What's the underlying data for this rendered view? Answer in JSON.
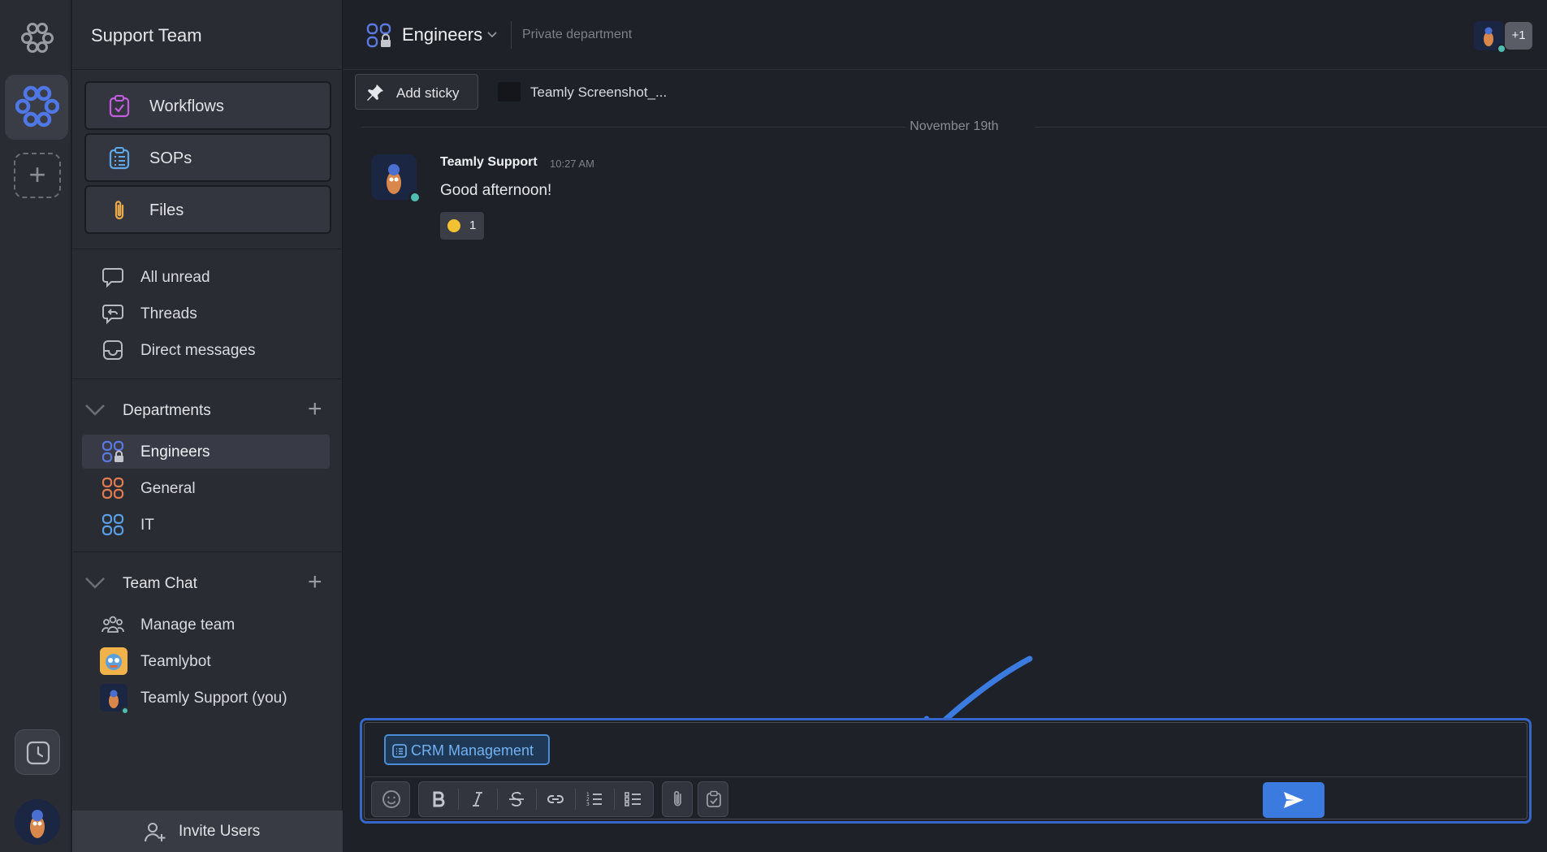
{
  "workspace": {
    "name": "Support Team"
  },
  "tools": [
    {
      "label": "Workflows",
      "icon": "workflows-icon"
    },
    {
      "label": "SOPs",
      "icon": "sops-icon"
    },
    {
      "label": "Files",
      "icon": "paperclip-icon"
    }
  ],
  "nav": [
    {
      "label": "All unread",
      "icon": "chat-bubble-icon"
    },
    {
      "label": "Threads",
      "icon": "threads-icon"
    },
    {
      "label": "Direct messages",
      "icon": "inbox-icon"
    }
  ],
  "departments": {
    "label": "Departments",
    "items": [
      {
        "label": "Engineers",
        "color": "#5b7ae0",
        "active": true,
        "locked": true
      },
      {
        "label": "General",
        "color": "#e07c4f"
      },
      {
        "label": "IT",
        "color": "#5a9fe6"
      }
    ]
  },
  "team_chat": {
    "label": "Team Chat",
    "items": [
      {
        "label": "Manage team",
        "icon": "team-icon"
      },
      {
        "label": "Teamlybot",
        "icon": "bot-avatar"
      },
      {
        "label": "Teamly Support (you)",
        "icon": "user-avatar"
      }
    ]
  },
  "invite": {
    "label": "Invite Users"
  },
  "channel": {
    "name": "Engineers",
    "description": "Private department",
    "members_more": "+1"
  },
  "stickies": {
    "add_label": "Add sticky",
    "file_label": "Teamly Screenshot_..."
  },
  "messages": {
    "date": "November 19th",
    "items": [
      {
        "author": "Teamly Support",
        "time": "10:27 AM",
        "text": "Good afternoon!",
        "reaction_count": "1"
      }
    ]
  },
  "composer": {
    "chip_label": "CRM Management"
  },
  "colors": {
    "accent": "#3b7be0",
    "online": "#4fbdb0",
    "chip_text": "#72b2f3"
  }
}
